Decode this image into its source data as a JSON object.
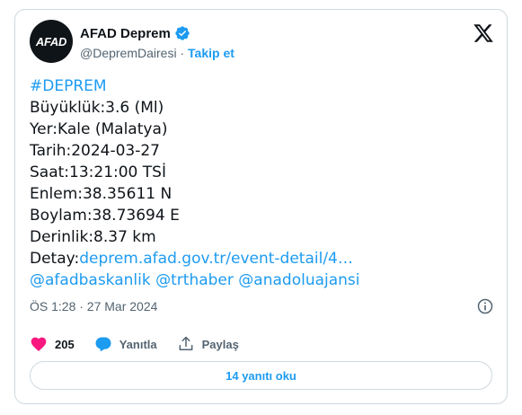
{
  "author": {
    "avatar_text": "AFAD",
    "name": "AFAD Deprem",
    "handle": "@DepremDairesi",
    "separator": "·",
    "follow_label": "Takip et"
  },
  "tweet": {
    "hashtag": "#DEPREM",
    "lines": [
      "Büyüklük:3.6 (Ml)",
      "Yer:Kale (Malatya)",
      "Tarih:2024-03-27",
      "Saat:13:21:00 TSİ",
      "Enlem:38.35611 N",
      "Boylam:38.73694 E",
      "Derinlik:8.37 km"
    ],
    "detail_label": "Detay:",
    "detail_link": "deprem.afad.gov.tr/event-detail/4…",
    "mentions": [
      "@afadbaskanlik",
      "@trthaber",
      "@anadoluajansi"
    ]
  },
  "timestamp": "ÖS 1:28 · 27 Mar 2024",
  "actions": {
    "likes": "205",
    "reply_label": "Yanıtla",
    "share_label": "Paylaş"
  },
  "read_replies_label": "14 yanıtı oku",
  "colors": {
    "accent": "#1d9bf0",
    "like": "#f91880",
    "text": "#0f1419",
    "muted": "#536471",
    "border": "#cfd9de"
  },
  "icons": [
    "verified-badge-icon",
    "x-logo-icon",
    "info-icon",
    "heart-icon",
    "reply-bubble-icon",
    "share-icon"
  ]
}
